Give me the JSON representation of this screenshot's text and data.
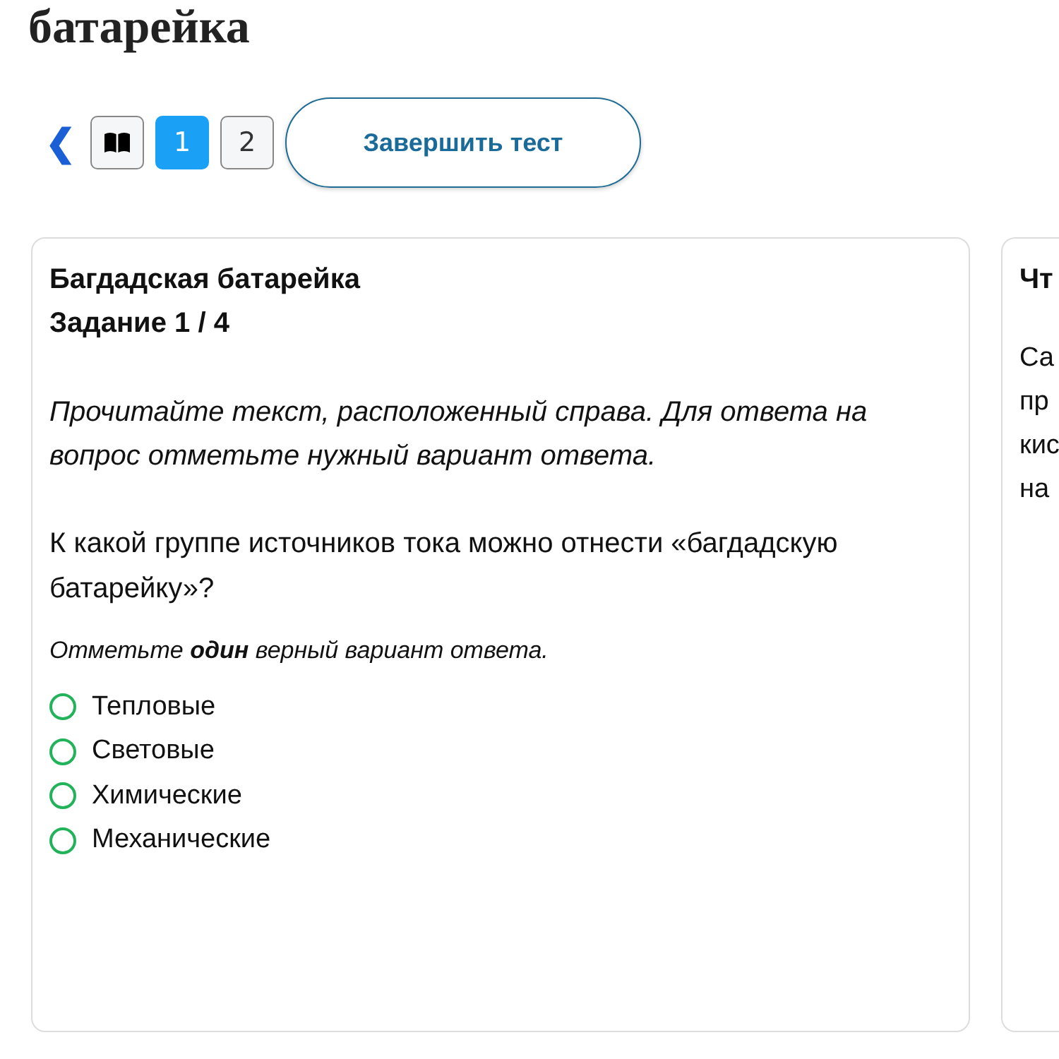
{
  "page_title": "батарейка",
  "nav": {
    "back": "❮",
    "pages": [
      {
        "kind": "book",
        "selected": false
      },
      {
        "kind": "number",
        "label": "1",
        "selected": true
      },
      {
        "kind": "number",
        "label": "2",
        "selected": false
      }
    ],
    "finish_button": "Завершить тест"
  },
  "task_card": {
    "title": "Багдадская батарейка",
    "counter": "Задание 1 / 4",
    "instruction": "Прочитайте текст, расположенный справа. Для ответа на вопрос отметьте нужный вариант ответа.",
    "question": "К какой группе источников тока можно отнести «багдадскую батарейку»?",
    "hint": "Отметьте **один** верный вариант ответа.",
    "options": [
      {
        "label": "Тепловые",
        "checked": false
      },
      {
        "label": "Световые",
        "checked": false
      },
      {
        "label": "Химические",
        "checked": false
      },
      {
        "label": "Механические",
        "checked": false
      }
    ]
  },
  "text_card": {
    "title": "Чт",
    "lines": [
      "Са",
      "пр",
      "кис",
      "на"
    ]
  }
}
